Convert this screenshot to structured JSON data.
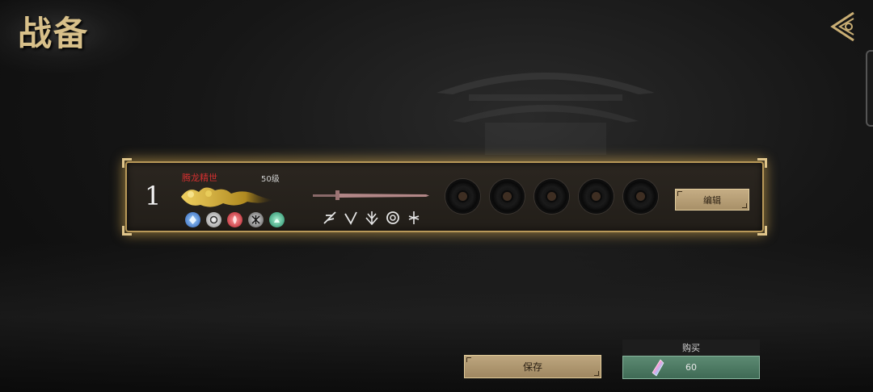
{
  "header": {
    "title": "战备"
  },
  "loadout": {
    "slot_number": "1",
    "hero_name": "腾龙精世",
    "level": "50级",
    "skills": [
      "water-skill-icon",
      "wind-skill-icon",
      "fire-skill-icon",
      "shadow-skill-icon",
      "wood-skill-icon"
    ],
    "moves": [
      "slash-move-icon",
      "pierce-move-icon",
      "spread-move-icon",
      "spin-move-icon",
      "thrust-move-icon"
    ],
    "gear_slots": 5,
    "edit_label": "编辑"
  },
  "footer": {
    "save_label": "保存",
    "buy_title": "购买",
    "buy_price": "60"
  },
  "colors": {
    "gold_frame": "#b89858",
    "button_tan": "#bda67e",
    "button_green": "#4f7a63",
    "hero_name_red": "#d23030"
  }
}
